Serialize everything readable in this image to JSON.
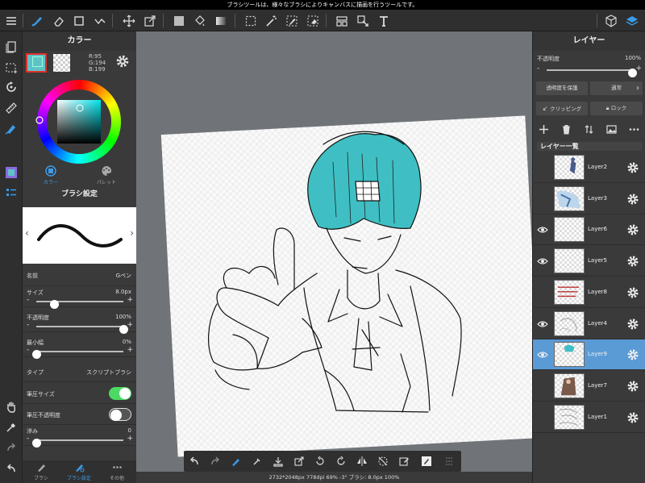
{
  "status_bar": {
    "text": "ブラシツールは、様々なブラシによりキャンバスに描画を行うツールです。"
  },
  "toolbar": {
    "menu_icon": "hamburger-icon",
    "tools": [
      "brush-icon",
      "eraser-icon",
      "select-rect-icon",
      "snap-icon",
      "move-icon",
      "transform-icon",
      "fill-color-icon",
      "bucket-icon",
      "gradient-icon",
      "select-icon",
      "magic-wand-icon",
      "select-pen-icon",
      "select-eraser-icon",
      "layer-move-icon",
      "operation-icon",
      "text-icon"
    ],
    "right": [
      "material-icon",
      "layers-icon"
    ]
  },
  "left_strip": [
    "page-icon",
    "selection-icon",
    "rotate-icon",
    "ruler-icon",
    "fill-pen-icon",
    "color-panel-icon",
    "brush-list-icon",
    "hand-icon",
    "eyedropper-icon",
    "redo-icon",
    "undo-icon"
  ],
  "color_panel": {
    "title": "カラー",
    "rgb": {
      "r": "R:95",
      "g": "G:194",
      "b": "B:199"
    },
    "main_color": "#5fc2c7",
    "tabs": [
      "カラー",
      "パレット"
    ]
  },
  "brush_panel": {
    "title": "ブラシ設定",
    "name_label": "名前",
    "name_value": "Gペン",
    "size_label": "サイズ",
    "size_value": "8.0px",
    "size_level": 0.2,
    "opacity_label": "不透明度",
    "opacity_value": "100%",
    "opacity_level": 1.0,
    "min_width_label": "最小幅",
    "min_width_value": "0%",
    "min_width_level": 0.0,
    "type_label": "タイプ",
    "type_value": "スクリプトブラシ",
    "pressure_size_label": "筆圧サイズ",
    "pressure_size_on": true,
    "pressure_opacity_label": "筆圧不透明度",
    "pressure_opacity_on": false,
    "blur_label": "滲み",
    "blur_value": "0",
    "blur_level": 0.0
  },
  "left_tabs": [
    "ブラシ",
    "ブラシ設定",
    "その他"
  ],
  "canvas_status": "2732*2048px 778dpi 69% -3° ブラシ: 8.0px 100%",
  "layer_panel": {
    "title": "レイヤー",
    "opacity_label": "不透明度",
    "opacity_value": "100%",
    "opacity_level": 1.0,
    "protect_alpha": "透明度を保護",
    "blend_mode": "通常",
    "clipping": "クリッピング",
    "lock": "ロック",
    "list_header": "レイヤー一覧",
    "layers": [
      {
        "name": "Layer2",
        "visible": false,
        "selected": false
      },
      {
        "name": "Layer3",
        "visible": false,
        "selected": false
      },
      {
        "name": "Layer6",
        "visible": true,
        "selected": false
      },
      {
        "name": "Layer5",
        "visible": true,
        "selected": false
      },
      {
        "name": "Layer8",
        "visible": false,
        "selected": false
      },
      {
        "name": "Layer4",
        "visible": true,
        "selected": false
      },
      {
        "name": "Layer9",
        "visible": true,
        "selected": true
      },
      {
        "name": "Layer7",
        "visible": false,
        "selected": false
      },
      {
        "name": "Layer1",
        "visible": false,
        "selected": false
      }
    ]
  },
  "bottom_toolbar": [
    "undo-icon",
    "redo-icon",
    "brush-settings-icon",
    "eyedropper-icon",
    "save-icon",
    "transform-icon",
    "rotate-left-icon",
    "rotate-right-icon",
    "flip-icon",
    "hide-selection-icon",
    "clear-icon",
    "edit-icon",
    "grid-icon"
  ]
}
